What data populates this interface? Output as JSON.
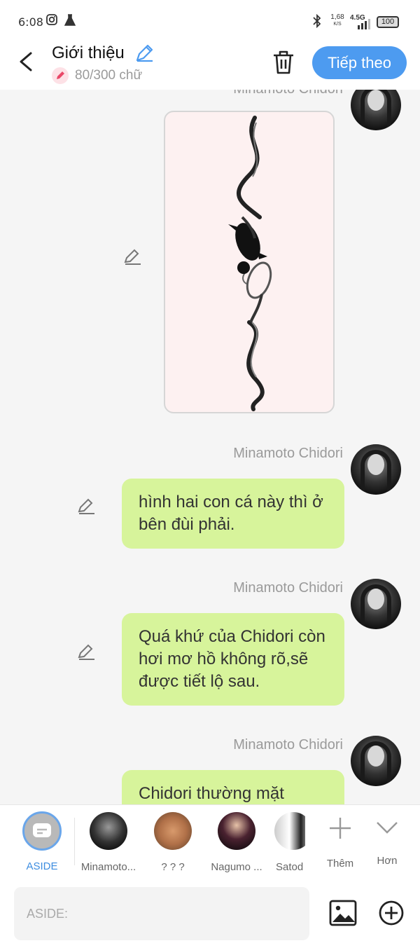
{
  "status": {
    "time": "6:08",
    "speed_value": "1,68",
    "speed_unit": "K/S",
    "network": "4.5G",
    "battery": "100"
  },
  "header": {
    "title": "Giới thiệu",
    "char_count": "80/300 chữ",
    "next_label": "Tiếp theo"
  },
  "messages": [
    {
      "sender": "Minamoto Chidori",
      "type": "image"
    },
    {
      "sender": "Minamoto Chidori",
      "type": "text",
      "text": "hình hai con cá này thì ở bên đùi phải."
    },
    {
      "sender": "Minamoto Chidori",
      "type": "text",
      "text": "Quá khứ của Chidori còn hơi mơ hồ không rõ,sẽ được tiết lộ sau."
    },
    {
      "sender": "Minamoto Chidori",
      "type": "text",
      "text": "Chidori thường mặt"
    }
  ],
  "characters": [
    {
      "label": "ASIDE",
      "selected": true
    },
    {
      "label": "Minamoto..."
    },
    {
      "label": "? ? ?"
    },
    {
      "label": "Nagumo ..."
    },
    {
      "label": "Satod"
    }
  ],
  "actions": {
    "more_label": "Thêm",
    "collapse_label": "Hơn"
  },
  "input": {
    "placeholder": "ASIDE:"
  },
  "colors": {
    "accent": "#4d9bf0",
    "bubble": "#d7f49b",
    "background": "#f5f5f5"
  }
}
